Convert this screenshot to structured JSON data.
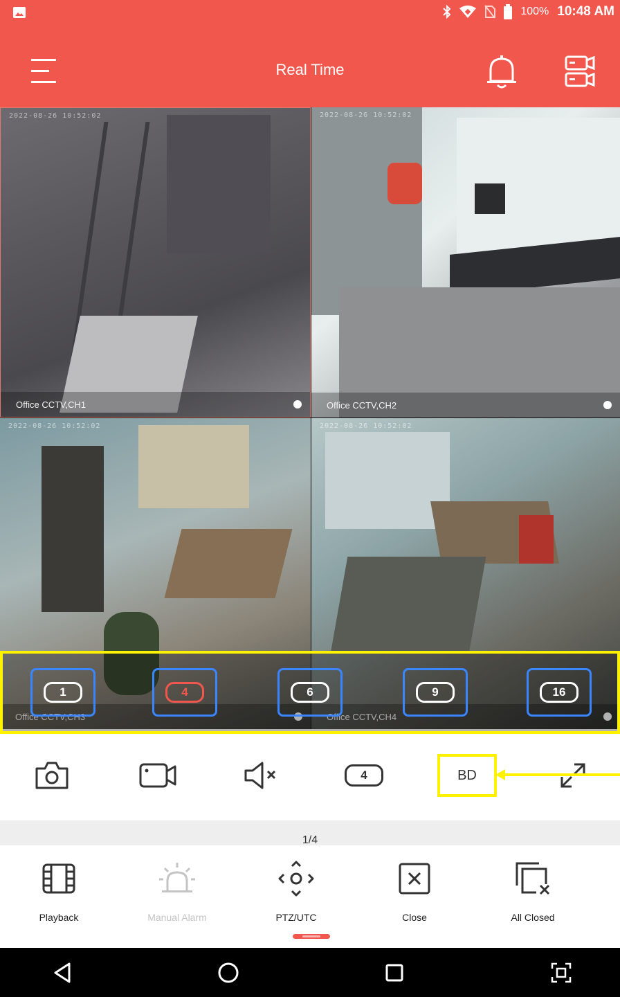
{
  "status_bar": {
    "battery": "100%",
    "time": "10:48 AM",
    "icons": [
      "gallery-icon",
      "bluetooth-icon",
      "wifi-icon",
      "no-sim-icon",
      "battery-icon"
    ]
  },
  "header": {
    "title": "Real Time",
    "menu_icon": "menu-icon",
    "alarm_icon": "bell-icon",
    "devices_icon": "device-list-icon",
    "color": "#f2574d"
  },
  "channels": [
    {
      "label": "Office CCTV,CH1",
      "timestamp": "2022-08-26 10:52:02"
    },
    {
      "label": "Office CCTV,CH2",
      "timestamp": "2022-08-26 10:52:02"
    },
    {
      "label": "Office CCTV,CH3",
      "timestamp": "2022-08-26 10:52:02"
    },
    {
      "label": "Office CCTV,CH4",
      "timestamp": "2022-08-26 10:52:02"
    }
  ],
  "split_options": [
    {
      "label": "1",
      "active": false
    },
    {
      "label": "4",
      "active": true
    },
    {
      "label": "6",
      "active": false
    },
    {
      "label": "9",
      "active": false
    },
    {
      "label": "16",
      "active": false
    }
  ],
  "toolbar": {
    "snapshot_icon": "camera-icon",
    "record_icon": "video-record-icon",
    "mute_icon": "speaker-muted-icon",
    "split_label": "4",
    "stream_label": "BD",
    "fullscreen_icon": "expand-icon"
  },
  "page_indicator": "1/4",
  "actions": [
    {
      "label": "Playback",
      "icon": "film-icon",
      "enabled": true
    },
    {
      "label": "Manual Alarm",
      "icon": "alarm-light-icon",
      "enabled": false
    },
    {
      "label": "PTZ/UTC",
      "icon": "ptz-icon",
      "enabled": true
    },
    {
      "label": "Close",
      "icon": "close-box-icon",
      "enabled": true
    },
    {
      "label": "All Closed",
      "icon": "close-all-icon",
      "enabled": true
    }
  ],
  "annotation_color": "#fff200",
  "selection_color": "#3a86ff"
}
